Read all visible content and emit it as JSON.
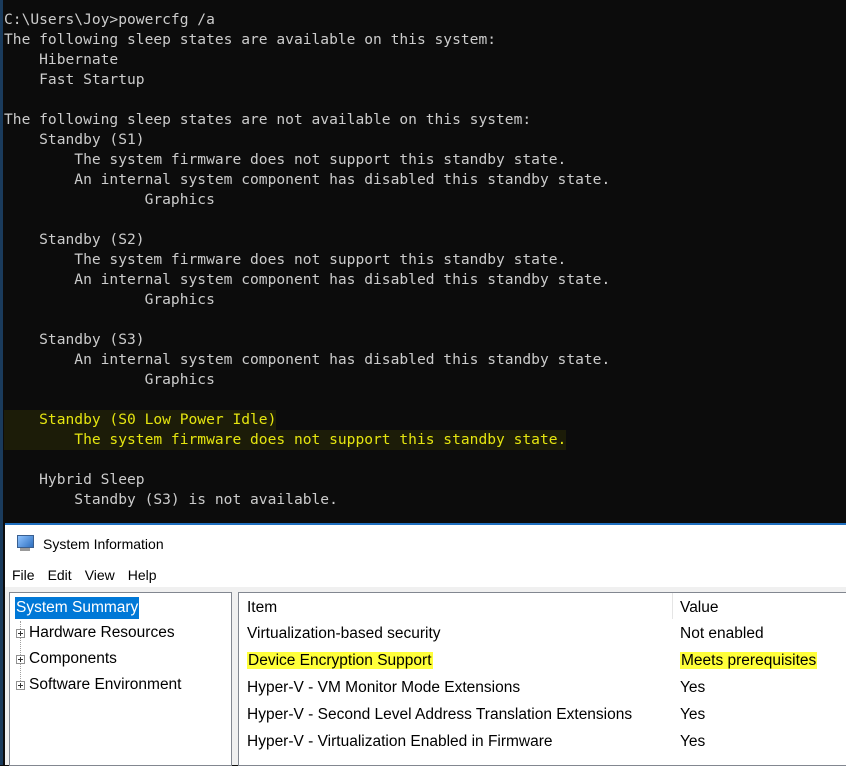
{
  "console": {
    "lines": [
      {
        "text": "C:\\Users\\Joy>powercfg /a",
        "highlight": false
      },
      {
        "text": "The following sleep states are available on this system:",
        "highlight": false
      },
      {
        "text": "    Hibernate",
        "highlight": false
      },
      {
        "text": "    Fast Startup",
        "highlight": false
      },
      {
        "text": "",
        "highlight": false
      },
      {
        "text": "The following sleep states are not available on this system:",
        "highlight": false
      },
      {
        "text": "    Standby (S1)",
        "highlight": false
      },
      {
        "text": "        The system firmware does not support this standby state.",
        "highlight": false
      },
      {
        "text": "        An internal system component has disabled this standby state.",
        "highlight": false
      },
      {
        "text": "                Graphics",
        "highlight": false
      },
      {
        "text": "",
        "highlight": false
      },
      {
        "text": "    Standby (S2)",
        "highlight": false
      },
      {
        "text": "        The system firmware does not support this standby state.",
        "highlight": false
      },
      {
        "text": "        An internal system component has disabled this standby state.",
        "highlight": false
      },
      {
        "text": "                Graphics",
        "highlight": false
      },
      {
        "text": "",
        "highlight": false
      },
      {
        "text": "    Standby (S3)",
        "highlight": false
      },
      {
        "text": "        An internal system component has disabled this standby state.",
        "highlight": false
      },
      {
        "text": "                Graphics",
        "highlight": false
      },
      {
        "text": "",
        "highlight": false
      },
      {
        "text": "    Standby (S0 Low Power Idle)",
        "highlight": true
      },
      {
        "text": "        The system firmware does not support this standby state.",
        "highlight": true
      },
      {
        "text": "",
        "highlight": false
      },
      {
        "text": "    Hybrid Sleep",
        "highlight": false
      },
      {
        "text": "        Standby (S3) is not available.",
        "highlight": false
      }
    ]
  },
  "sysinfo": {
    "title": "System Information",
    "icon": "system-information-icon",
    "menu": [
      "File",
      "Edit",
      "View",
      "Help"
    ],
    "tree": {
      "selected": "System Summary",
      "children": [
        "Hardware Resources",
        "Components",
        "Software Environment"
      ]
    },
    "table": {
      "headers": {
        "item": "Item",
        "value": "Value"
      },
      "rows": [
        {
          "item": "Virtualization-based security",
          "value": "Not enabled",
          "highlight": false
        },
        {
          "item": "Device Encryption Support",
          "value": "Meets prerequisites",
          "highlight": true
        },
        {
          "item": "Hyper-V - VM Monitor Mode Extensions",
          "value": "Yes",
          "highlight": false
        },
        {
          "item": "Hyper-V - Second Level Address Translation Extensions",
          "value": "Yes",
          "highlight": false
        },
        {
          "item": "Hyper-V - Virtualization Enabled in Firmware",
          "value": "Yes",
          "highlight": false
        }
      ]
    }
  },
  "colors": {
    "console_bg": "#0c0c0c",
    "console_text": "#cccccc",
    "console_highlight_text": "#e5e510",
    "selection_blue": "#0078d7",
    "marker_yellow": "#ffff3a"
  }
}
